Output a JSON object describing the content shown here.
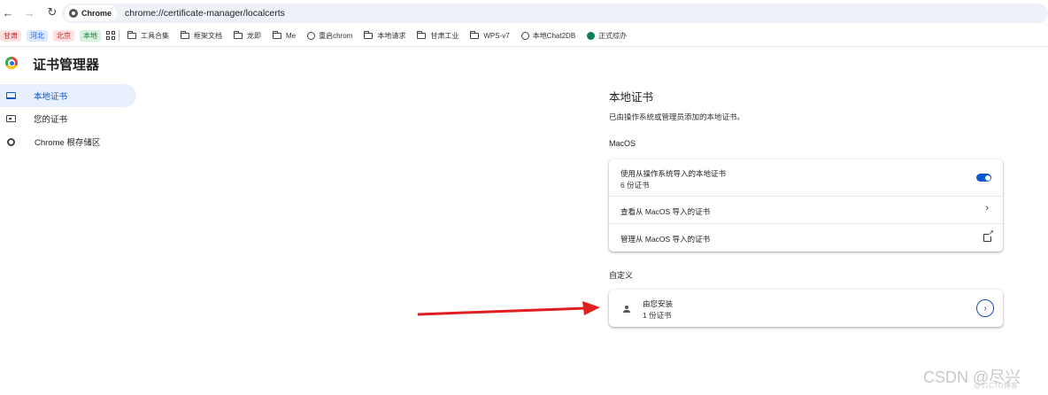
{
  "browser": {
    "chip_label": "Chrome",
    "url": "chrome://certificate-manager/localcerts",
    "nav": {
      "back": "←",
      "forward": "→",
      "reload": "↻"
    }
  },
  "bookmarks": {
    "tags": [
      "甘肃",
      "河北",
      "北京",
      "本地"
    ],
    "items": [
      {
        "label": "工具合集",
        "icon": "folder-icon"
      },
      {
        "label": "框架文档",
        "icon": "folder-icon"
      },
      {
        "label": "龙即",
        "icon": "folder-icon"
      },
      {
        "label": "Me",
        "icon": "folder-icon"
      },
      {
        "label": "重启chrom",
        "icon": "globe-icon"
      },
      {
        "label": "本地请求",
        "icon": "folder-icon"
      },
      {
        "label": "甘肃工业",
        "icon": "folder-icon"
      },
      {
        "label": "WPS-v7",
        "icon": "folder-icon"
      },
      {
        "label": "本地Chat2DB",
        "icon": "globe-icon"
      },
      {
        "label": "正式综办",
        "icon": "c-logo-icon"
      }
    ]
  },
  "app": {
    "title": "证书管理器"
  },
  "sidebar": {
    "items": [
      {
        "label": "本地证书",
        "active": true,
        "icon": "laptop-icon"
      },
      {
        "label": "您的证书",
        "active": false,
        "icon": "badge-icon"
      },
      {
        "label": "Chrome 根存储区",
        "active": false,
        "icon": "gear-icon"
      }
    ]
  },
  "main": {
    "title": "本地证书",
    "subtitle": "已由操作系统或管理员添加的本地证书。",
    "macos": {
      "label": "MacOS",
      "rows": [
        {
          "text": "使用从操作系统导入的本地证书",
          "sub": "6 份证书",
          "control": "toggle",
          "toggle_on": true
        },
        {
          "text": "查看从 MacOS 导入的证书",
          "control": "chevron",
          "glyph": "›"
        },
        {
          "text": "管理从 MacOS 导入的证书",
          "control": "external-link"
        }
      ]
    },
    "custom": {
      "label": "自定义",
      "row": {
        "text": "由您安装",
        "sub": "1 份证书",
        "glyph": "›"
      }
    }
  },
  "annotation": {
    "arrow_color": "#e02020"
  },
  "watermark": {
    "text": "CSDN @尽兴",
    "small": "@51CTO博客"
  },
  "colors": {
    "accent": "#0b57d0",
    "active_bg": "#e8effd"
  }
}
